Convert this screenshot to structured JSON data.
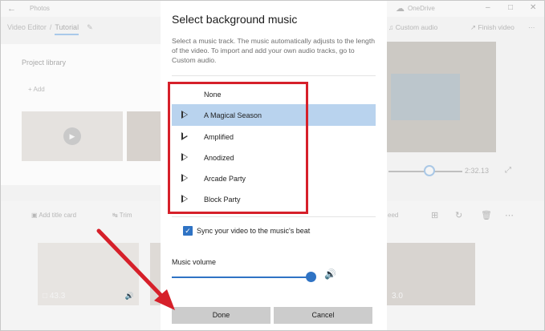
{
  "background_app": {
    "app_title": "Photos",
    "cloud_label": "OneDrive",
    "breadcrumb": {
      "root": "Video Editor",
      "current": "Tutorial"
    },
    "custom_audio_label": "Custom audio",
    "finish_video_label": "Finish video",
    "project_library_title": "Project library",
    "add_label": "Add",
    "playback_time": "2:32.13",
    "tools": {
      "add_title_card": "Add title card",
      "trim": "Trim",
      "speed": "eed"
    },
    "clips": [
      {
        "duration": "43.3"
      },
      {
        "duration": "3.0"
      }
    ]
  },
  "dialog": {
    "title": "Select background music",
    "description": "Select a music track. The music automatically adjusts to the length of the video. To import and add your own audio tracks, go to Custom audio.",
    "tracks": [
      {
        "label": "None",
        "has_icon": false,
        "selected": false
      },
      {
        "label": "A Magical Season",
        "has_icon": true,
        "selected": true
      },
      {
        "label": "Amplified",
        "has_icon": true,
        "selected": false
      },
      {
        "label": "Anodized",
        "has_icon": true,
        "selected": false
      },
      {
        "label": "Arcade Party",
        "has_icon": true,
        "selected": false
      },
      {
        "label": "Block Party",
        "has_icon": true,
        "selected": false
      }
    ],
    "sync_label": "Sync your video to the music's beat",
    "sync_checked": true,
    "volume_label": "Music volume",
    "volume_level": 0.97,
    "done_label": "Done",
    "cancel_label": "Cancel"
  },
  "colors": {
    "accent": "#2f73c4",
    "selected_row": "#b9d3ee",
    "highlight_box": "#d6202a",
    "button": "#cccccc"
  }
}
